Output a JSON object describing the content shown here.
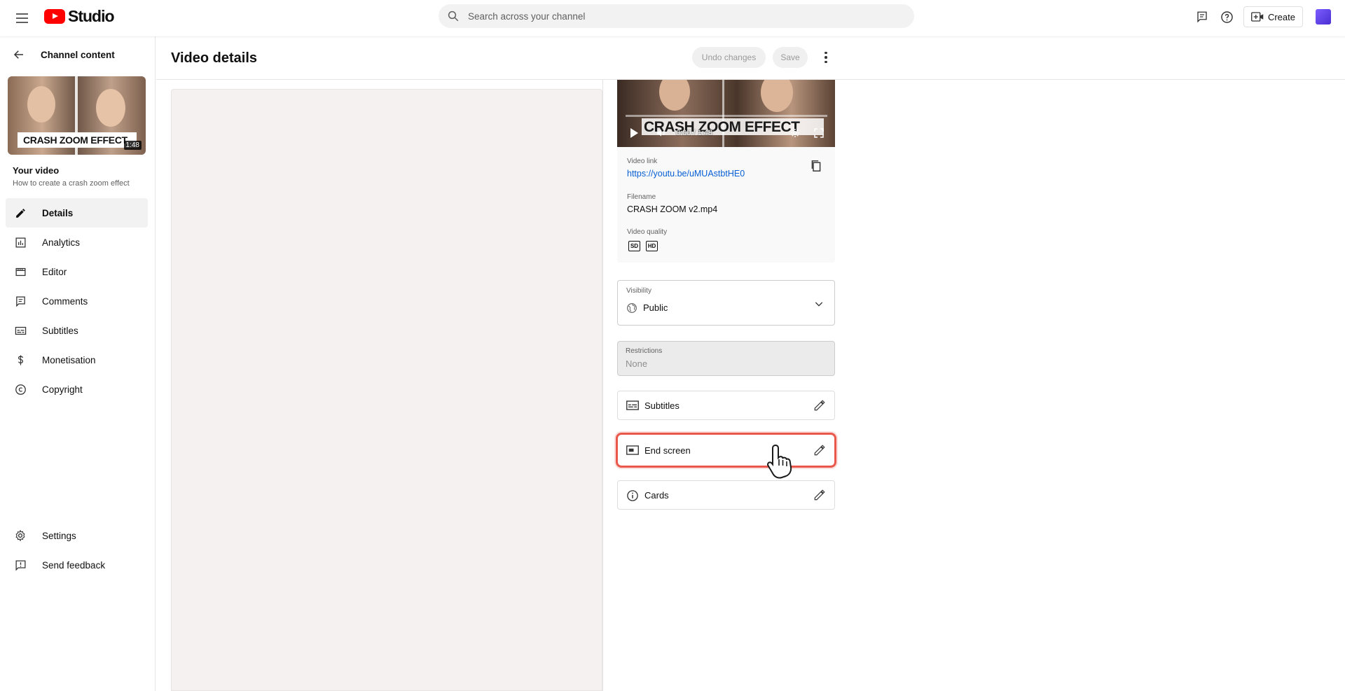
{
  "topbar": {
    "logo_text": "Studio",
    "search_placeholder": "Search across your channel",
    "create_label": "Create"
  },
  "sidebar": {
    "back_label": "Channel content",
    "thumbnail": {
      "caption": "CRASH ZOOM EFFECT",
      "duration": "1:48"
    },
    "your_video_label": "Your video",
    "video_title": "How to create a crash zoom effect",
    "items": [
      {
        "label": "Details",
        "icon": "pencil-icon",
        "active": true
      },
      {
        "label": "Analytics",
        "icon": "analytics-icon",
        "active": false
      },
      {
        "label": "Editor",
        "icon": "editor-icon",
        "active": false
      },
      {
        "label": "Comments",
        "icon": "comments-icon",
        "active": false
      },
      {
        "label": "Subtitles",
        "icon": "subtitles-icon",
        "active": false
      },
      {
        "label": "Monetisation",
        "icon": "dollar-icon",
        "active": false
      },
      {
        "label": "Copyright",
        "icon": "copyright-icon",
        "active": false
      }
    ],
    "bottom_items": [
      {
        "label": "Settings",
        "icon": "gear-icon"
      },
      {
        "label": "Send feedback",
        "icon": "feedback-icon"
      }
    ]
  },
  "header": {
    "title": "Video details",
    "undo_label": "Undo changes",
    "save_label": "Save"
  },
  "preview": {
    "caption": "CRASH ZOOM EFFECT",
    "time": "0:00 / 1:48"
  },
  "info": {
    "video_link_label": "Video link",
    "video_link": "https://youtu.be/uMUAstbtHE0",
    "filename_label": "Filename",
    "filename": "CRASH ZOOM v2.mp4",
    "quality_label": "Video quality",
    "quality_badges": [
      "SD",
      "HD"
    ]
  },
  "visibility": {
    "label": "Visibility",
    "value": "Public"
  },
  "restrictions": {
    "label": "Restrictions",
    "value": "None"
  },
  "rows": {
    "subtitles": "Subtitles",
    "end_screen": "End screen",
    "cards": "Cards"
  },
  "colors": {
    "brand_red": "#ff0000",
    "link_blue": "#065fd4",
    "highlight": "#e9584b"
  }
}
